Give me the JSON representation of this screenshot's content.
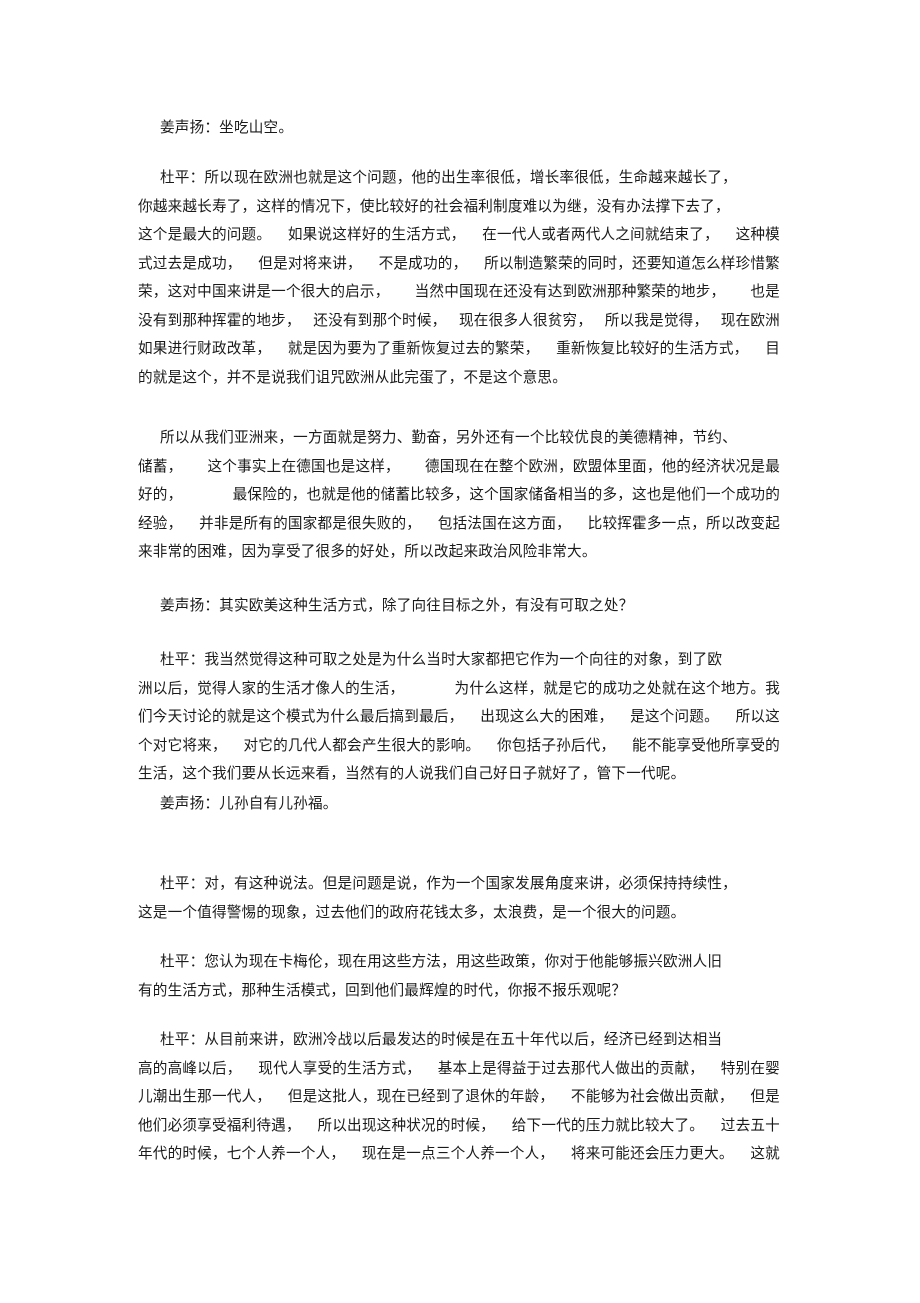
{
  "document": {
    "paragraphs": [
      {
        "speaker": "姜声扬",
        "lines": [
          [
            "姜声扬：坐吃山空。"
          ]
        ]
      },
      {
        "speaker": "杜平",
        "lines": [
          [
            "杜平：所以现在欧洲也就是这个问题，他的出生率很低，增长率很低，生命越来越长了，"
          ],
          [
            "你越来越长寿了，这样的情况下，使比较好的社会福利制度难以为继，没有办法撑下去了，"
          ],
          [
            "这个是最大的问题。",
            "如果说这样好的生活方式，",
            "在一代人或者两代人之间就结束了，",
            "这种模"
          ],
          [
            "式过去是成功，",
            "但是对将来讲，",
            "不是成功的，",
            "所以制造繁荣的同时，还要知道怎么样珍惜繁"
          ],
          [
            "荣，这对中国来讲是一个很大的启示，",
            "当然中国现在还没有达到欧洲那种繁荣的地步，",
            "也是"
          ],
          [
            "没有到那种挥霍的地步，",
            "还没有到那个时候，",
            "现在很多人很贫穷，",
            "所以我是觉得，",
            "现在欧洲"
          ],
          [
            "如果进行财政改革，",
            "就是因为要为了重新恢复过去的繁荣，",
            "重新恢复比较好的生活方式，",
            "目"
          ],
          [
            "的就是这个，并不是说我们诅咒欧洲从此完蛋了，不是这个意思。"
          ]
        ]
      },
      {
        "speaker": "杜平",
        "lines": [
          [
            "所以从我们亚洲来，一方面就是努力、勤奋，另外还有一个比较优良的美德精神，节约、"
          ],
          [
            "储蓄，",
            "这个事实上在德国也是这样，",
            "德国现在在整个欧洲，欧盟体里面，他的经济状况是最"
          ],
          [
            "好的，",
            "最保险的，也就是他的储蓄比较多，这个国家储备相当的多，这也是他们一个成功的"
          ],
          [
            "经验，",
            "并非是所有的国家都是很失败的，",
            "包括法国在这方面，",
            "比较挥霍多一点，所以改变起"
          ],
          [
            "来非常的困难，因为享受了很多的好处，所以改起来政治风险非常大。"
          ]
        ]
      },
      {
        "speaker": "姜声扬",
        "lines": [
          [
            "姜声扬：其实欧美这种生活方式，除了向往目标之外，有没有可取之处？"
          ]
        ]
      },
      {
        "speaker": "杜平",
        "lines": [
          [
            "杜平：我当然觉得这种可取之处是为什么当时大家都把它作为一个向往的对象，到了欧"
          ],
          [
            "洲以后，觉得人家的生活才像人的生活，",
            "为什么这样，就是它的成功之处就在这个地方。我"
          ],
          [
            "们今天讨论的就是这个模式为什么最后搞到最后，",
            "出现这么大的困难，",
            "是这个问题。",
            "所以这"
          ],
          [
            "个对它将来，",
            "对它的几代人都会产生很大的影响。",
            "你包括子孙后代，",
            "能不能享受他所享受的"
          ],
          [
            "生活，这个我们要从长远来看，当然有的人说我们自己好日子就好了，管下一代呢。"
          ]
        ]
      },
      {
        "speaker": "姜声扬",
        "lines": [
          [
            "姜声扬：儿孙自有儿孙福。"
          ]
        ]
      },
      {
        "speaker": "杜平",
        "lines": [
          [
            "杜平：对，有这种说法。但是问题是说，作为一个国家发展角度来讲，必须保持持续性，"
          ],
          [
            "这是一个值得警惕的现象，过去他们的政府花钱太多，太浪费，是一个很大的问题。"
          ]
        ]
      },
      {
        "speaker": "杜平",
        "lines": [
          [
            "杜平：您认为现在卡梅伦，现在用这些方法，用这些政策，你对于他能够振兴欧洲人旧"
          ],
          [
            "有的生活方式，那种生活模式，回到他们最辉煌的时代，你报不报乐观呢？"
          ]
        ]
      },
      {
        "speaker": "杜平",
        "lines": [
          [
            "杜平：从目前来讲，欧洲冷战以后最发达的时候是在五十年代以后，经济已经到达相当"
          ],
          [
            "高的高峰以后，",
            "现代人享受的生活方式，",
            "基本上是得益于过去那代人做出的贡献，",
            "特别在婴"
          ],
          [
            "儿潮出生那一代人，",
            "但是这批人，现在已经到了退休的年龄，",
            "不能够为社会做出贡献，",
            "但是"
          ],
          [
            "他们必须享受福利待遇，",
            "所以出现这种状况的时候，",
            "给下一代的压力就比较大了。",
            "过去五十"
          ],
          [
            "年代的时候，七个人养一个人，",
            "现在是一点三个人养一个人，",
            "将来可能还会压力更大。",
            "这就"
          ]
        ]
      }
    ]
  }
}
